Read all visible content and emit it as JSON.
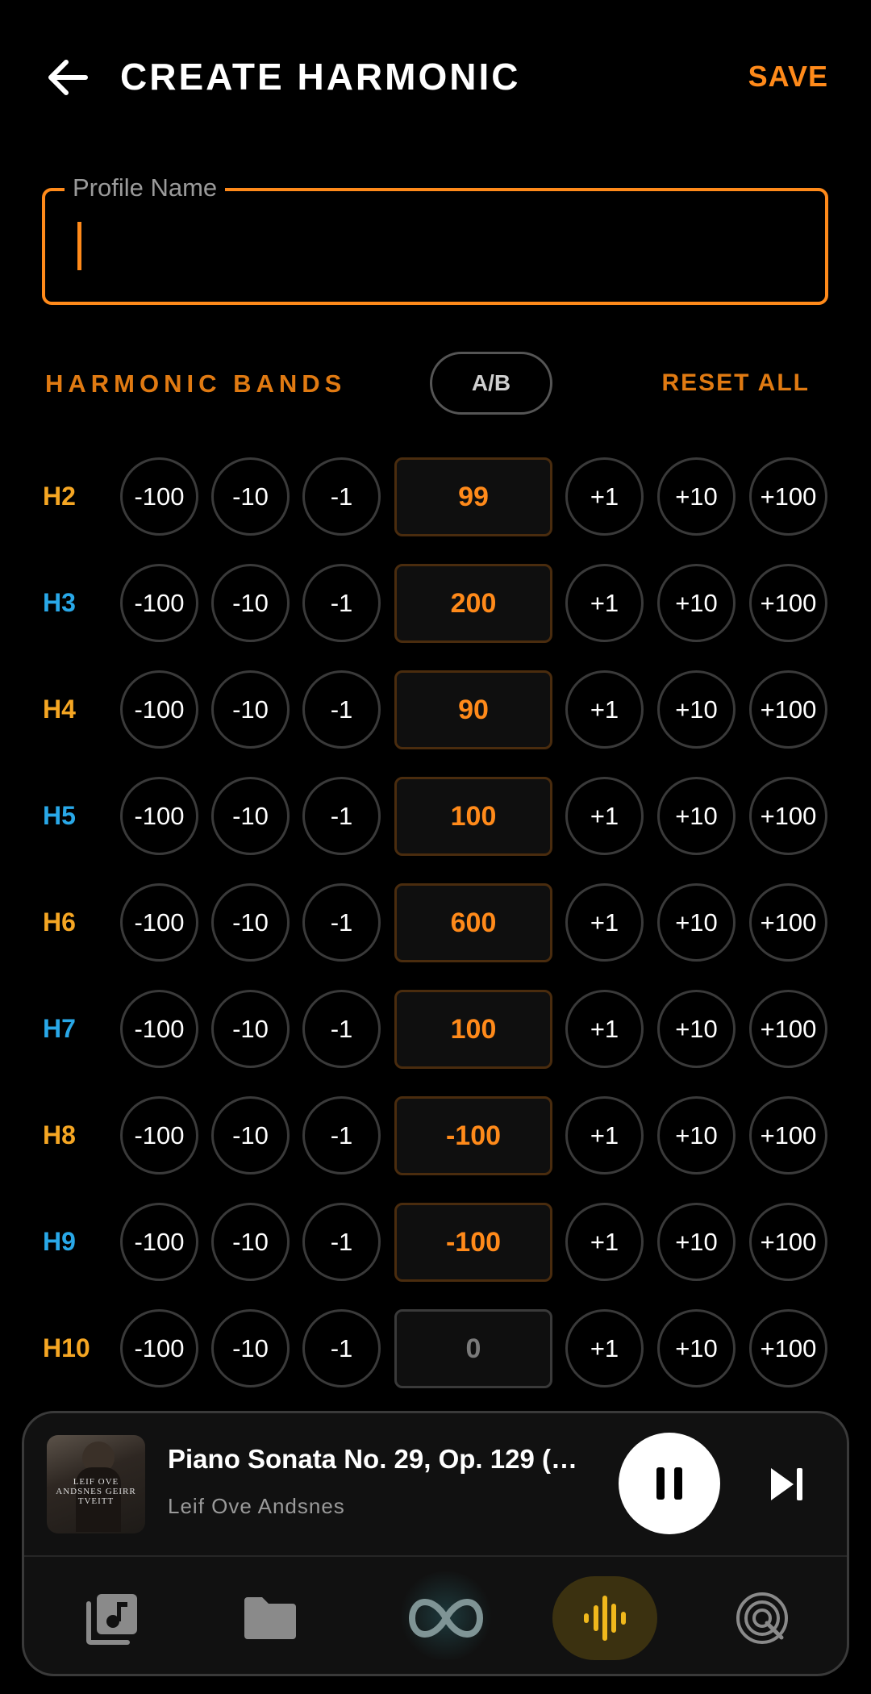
{
  "header": {
    "title": "CREATE HARMONIC",
    "save_label": "SAVE",
    "back_icon": "arrow-left-icon"
  },
  "profile": {
    "label": "Profile Name",
    "value": "",
    "placeholder": ""
  },
  "section": {
    "title": "HARMONIC BANDS",
    "ab_label": "A/B",
    "reset_label": "RESET ALL"
  },
  "step_labels": {
    "minus100": "-100",
    "minus10": "-10",
    "minus1": "-1",
    "plus1": "+1",
    "plus10": "+10",
    "plus100": "+100"
  },
  "bands": [
    {
      "label": "H2",
      "value": "99",
      "color": "#f5a623"
    },
    {
      "label": "H3",
      "value": "200",
      "color": "#29a8e8"
    },
    {
      "label": "H4",
      "value": "90",
      "color": "#f5a623"
    },
    {
      "label": "H5",
      "value": "100",
      "color": "#29a8e8"
    },
    {
      "label": "H6",
      "value": "600",
      "color": "#f5a623"
    },
    {
      "label": "H7",
      "value": "100",
      "color": "#29a8e8"
    },
    {
      "label": "H8",
      "value": "-100",
      "color": "#f5a623"
    },
    {
      "label": "H9",
      "value": "-100",
      "color": "#29a8e8"
    },
    {
      "label": "H10",
      "value": "0",
      "color": "#f5a623"
    }
  ],
  "now_playing": {
    "title": "Piano Sonata No. 29, Op. 129 (…",
    "artist": "Leif Ove Andsnes",
    "album_art_text": "LEIF OVE ANDSNES GEIRR TVEITT",
    "is_playing": true
  },
  "nav": {
    "items": [
      {
        "name": "library",
        "icon": "music-library-icon"
      },
      {
        "name": "folders",
        "icon": "folder-icon"
      },
      {
        "name": "loop",
        "icon": "infinity-icon"
      },
      {
        "name": "harmonics",
        "icon": "waveform-icon",
        "active": true
      },
      {
        "name": "radio",
        "icon": "target-icon"
      }
    ]
  },
  "colors": {
    "accent": "#ff8a1a",
    "odd_band": "#f5a623",
    "even_band": "#29a8e8",
    "active_nav": "#f0b81c"
  }
}
